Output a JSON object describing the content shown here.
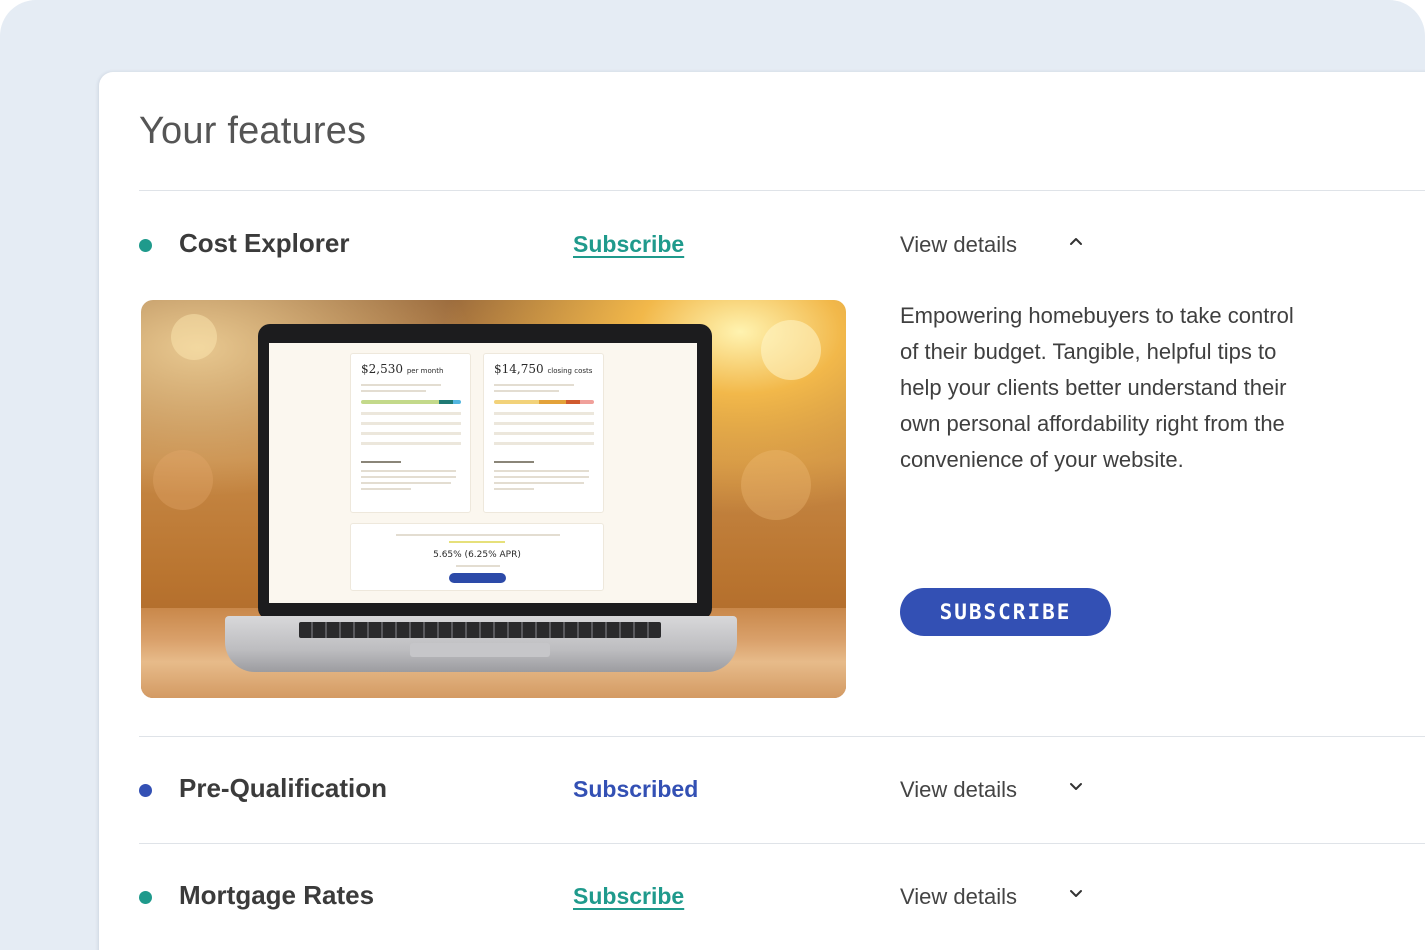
{
  "page": {
    "title": "Your features"
  },
  "colors": {
    "teal": "#1f9a8c",
    "blue": "#3350b4",
    "frame": "#e5ecf4"
  },
  "features": [
    {
      "name": "Cost Explorer",
      "status_label": "Subscribe",
      "status": "link",
      "status_color": "#1f9a8c",
      "dot_color": "#1f9a8c",
      "details_label": "View details",
      "expanded": true,
      "chevron": "chevron-up-icon",
      "description": "Empowering homebuyers to take control of their budget. Tangible, helpful tips to help your clients better understand their own personal affordability right from the convenience of your website.",
      "cta_label": "SUBSCRIBE",
      "screen": {
        "monthly_amount": "$2,530",
        "monthly_unit": "per month",
        "closing_amount": "$14,750",
        "closing_unit": "closing costs",
        "rate": "5.65% (6.25% APR)"
      }
    },
    {
      "name": "Pre-Qualification",
      "status_label": "Subscribed",
      "status": "text",
      "status_color": "#3350b4",
      "dot_color": "#3350b4",
      "details_label": "View details",
      "expanded": false,
      "chevron": "chevron-down-icon"
    },
    {
      "name": "Mortgage Rates",
      "status_label": "Subscribe",
      "status": "link",
      "status_color": "#1f9a8c",
      "dot_color": "#1f9a8c",
      "details_label": "View details",
      "expanded": false,
      "chevron": "chevron-down-icon"
    }
  ]
}
